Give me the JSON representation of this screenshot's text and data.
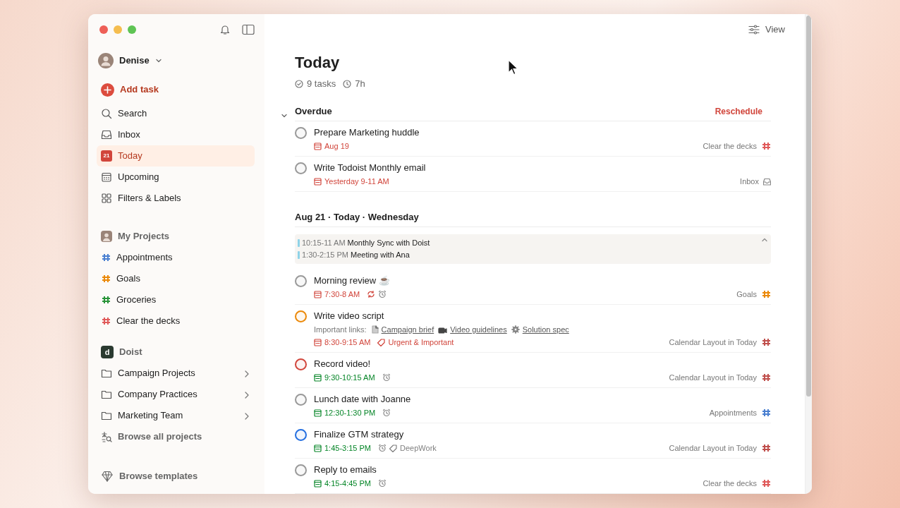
{
  "sidebar": {
    "user": {
      "name": "Denise"
    },
    "add_task": "Add task",
    "nav": [
      {
        "label": "Search",
        "kind": "search",
        "selected": false
      },
      {
        "label": "Inbox",
        "kind": "inbox",
        "selected": false
      },
      {
        "label": "Today",
        "kind": "today",
        "icon_text": "21",
        "selected": true
      },
      {
        "label": "Upcoming",
        "kind": "upcoming",
        "selected": false
      },
      {
        "label": "Filters & Labels",
        "kind": "filters",
        "selected": false
      }
    ],
    "groups": [
      {
        "title": "My Projects",
        "kind": "personal",
        "items": [
          {
            "label": "Appointments",
            "kind": "project",
            "color": "#4a7fd0"
          },
          {
            "label": "Goals",
            "kind": "project",
            "color": "#eb8909"
          },
          {
            "label": "Groceries",
            "kind": "project",
            "color": "#299438"
          },
          {
            "label": "Clear the decks",
            "kind": "project",
            "color": "#e05a5a"
          }
        ]
      },
      {
        "title": "Doist",
        "kind": "team",
        "avatar_letter": "d",
        "items": [
          {
            "label": "Campaign Projects",
            "kind": "folder"
          },
          {
            "label": "Company Practices",
            "kind": "folder"
          },
          {
            "label": "Marketing Team",
            "kind": "folder"
          },
          {
            "label": "Browse all projects",
            "kind": "browse"
          }
        ]
      }
    ],
    "footer": "Browse templates"
  },
  "header": {
    "view_button": "View"
  },
  "title": "Today",
  "stats": [
    {
      "kind": "tasks",
      "text": "9 tasks"
    },
    {
      "kind": "duration",
      "text": "7h"
    }
  ],
  "sections": [
    {
      "kind": "overdue",
      "title": "Overdue",
      "expanded": true,
      "action": "Reschedule",
      "tasks": [
        {
          "title": "Prepare Marketing huddle",
          "color": "#999999",
          "due": {
            "text": "Aug 19",
            "color": "#d1453b"
          },
          "recurring": false,
          "reminder": false,
          "project": {
            "text": "Clear the decks",
            "kind": "project",
            "color": "#e05a5a"
          }
        },
        {
          "title": "Write Todoist Monthly email",
          "color": "#999999",
          "due": {
            "text": "Yesterday 9-11 AM",
            "color": "#d1453b"
          },
          "recurring": false,
          "reminder": false,
          "project": {
            "text": "Inbox",
            "kind": "inbox"
          }
        }
      ]
    },
    {
      "kind": "day",
      "title": "Aug 21 · Today · Wednesday",
      "events_expanded": true,
      "events": [
        {
          "time": "10:15-11 AM",
          "title": "Monthly Sync with Doist",
          "color": "#8fd3e8"
        },
        {
          "time": "1:30-2:15 PM",
          "title": "Meeting with Ana",
          "color": "#8fd3e8"
        }
      ],
      "tasks": [
        {
          "title": "Morning review ☕",
          "color": "#999999",
          "due": {
            "text": "7:30-8 AM",
            "color": "#d1453b"
          },
          "recurring": true,
          "reminder": true,
          "project": {
            "text": "Goals",
            "kind": "project",
            "color": "#eb8909"
          }
        },
        {
          "title": "Write video script",
          "color": "#eb8909",
          "description": {
            "text": "Important links:",
            "links": [
              {
                "kind": "document",
                "text": "Campaign brief"
              },
              {
                "kind": "video",
                "text": "Video guidelines"
              },
              {
                "kind": "gear",
                "text": "Solution spec"
              }
            ]
          },
          "due": {
            "text": "8:30-9:15 AM",
            "color": "#d1453b"
          },
          "recurring": false,
          "reminder": false,
          "labels": [
            {
              "text": "Urgent & Important",
              "color": "#d1453b"
            }
          ],
          "project": {
            "text": "Calendar Layout in Today",
            "kind": "project",
            "color": "#c0504d"
          }
        },
        {
          "title": "Record video!",
          "color": "#d1453b",
          "due": {
            "text": "9:30-10:15 AM",
            "color": "#058527"
          },
          "recurring": false,
          "reminder": true,
          "project": {
            "text": "Calendar Layout in Today",
            "kind": "project",
            "color": "#c0504d"
          }
        },
        {
          "title": "Lunch date with Joanne",
          "color": "#999999",
          "due": {
            "text": "12:30-1:30 PM",
            "color": "#058527"
          },
          "recurring": false,
          "reminder": true,
          "project": {
            "text": "Appointments",
            "kind": "project",
            "color": "#4a7fd0"
          }
        },
        {
          "title": "Finalize GTM strategy",
          "color": "#246fe0",
          "due": {
            "text": "1:45-3:15 PM",
            "color": "#058527"
          },
          "recurring": false,
          "reminder": true,
          "labels": [
            {
              "text": "DeepWork",
              "color": "#808080"
            }
          ],
          "project": {
            "text": "Calendar Layout in Today",
            "kind": "project",
            "color": "#c0504d"
          }
        },
        {
          "title": "Reply to emails",
          "color": "#999999",
          "due": {
            "text": "4:15-4:45 PM",
            "color": "#058527"
          },
          "recurring": false,
          "reminder": true,
          "project": {
            "text": "Clear the decks",
            "kind": "project",
            "color": "#e05a5a"
          }
        }
      ]
    }
  ]
}
